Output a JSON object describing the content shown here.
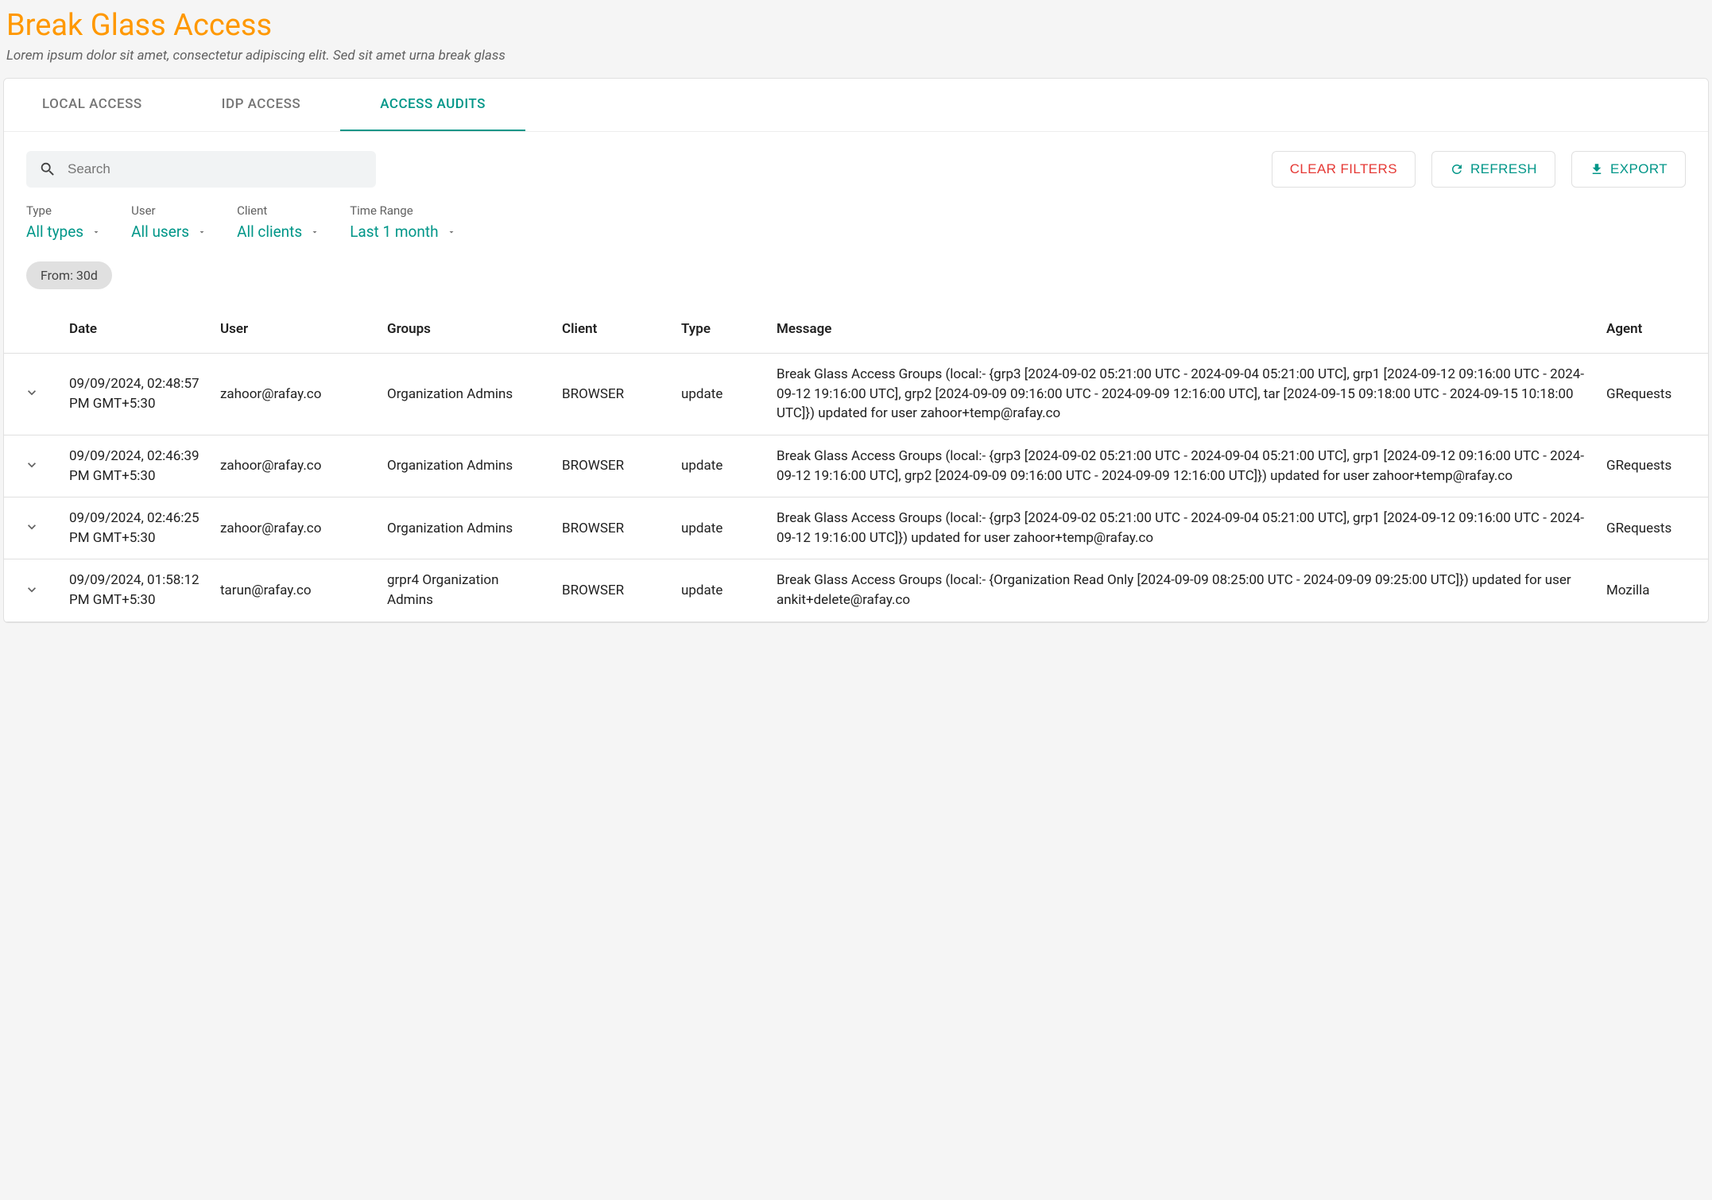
{
  "header": {
    "title": "Break Glass Access",
    "subtitle": "Lorem ipsum dolor sit amet, consectetur adipiscing elit. Sed sit amet urna break glass"
  },
  "tabs": [
    {
      "label": "LOCAL ACCESS",
      "active": false
    },
    {
      "label": "IDP ACCESS",
      "active": false
    },
    {
      "label": "ACCESS AUDITS",
      "active": true
    }
  ],
  "search": {
    "placeholder": "Search",
    "value": ""
  },
  "actions": {
    "clear": "CLEAR FILTERS",
    "refresh": "REFRESH",
    "export": "EXPORT"
  },
  "filters": {
    "type": {
      "label": "Type",
      "value": "All types"
    },
    "user": {
      "label": "User",
      "value": "All users"
    },
    "client": {
      "label": "Client",
      "value": "All clients"
    },
    "time_range": {
      "label": "Time Range",
      "value": "Last 1 month"
    }
  },
  "chips": [
    {
      "label": "From: 30d"
    }
  ],
  "columns": {
    "date": "Date",
    "user": "User",
    "groups": "Groups",
    "client": "Client",
    "type": "Type",
    "message": "Message",
    "agent": "Agent"
  },
  "rows": [
    {
      "date": "09/09/2024, 02:48:57 PM GMT+5:30",
      "user": "zahoor@rafay.co",
      "groups": "Organization Admins",
      "client": "BROWSER",
      "type": "update",
      "message": "Break Glass Access Groups (local:- {grp3 [2024-09-02 05:21:00 UTC - 2024-09-04 05:21:00 UTC], grp1 [2024-09-12 09:16:00 UTC - 2024-09-12 19:16:00 UTC], grp2 [2024-09-09 09:16:00 UTC - 2024-09-09 12:16:00 UTC], tar [2024-09-15 09:18:00 UTC - 2024-09-15 10:18:00 UTC]}) updated for user zahoor+temp@rafay.co",
      "agent": "GRequests"
    },
    {
      "date": "09/09/2024, 02:46:39 PM GMT+5:30",
      "user": "zahoor@rafay.co",
      "groups": "Organization Admins",
      "client": "BROWSER",
      "type": "update",
      "message": "Break Glass Access Groups (local:- {grp3 [2024-09-02 05:21:00 UTC - 2024-09-04 05:21:00 UTC], grp1 [2024-09-12 09:16:00 UTC - 2024-09-12 19:16:00 UTC], grp2 [2024-09-09 09:16:00 UTC - 2024-09-09 12:16:00 UTC]}) updated for user zahoor+temp@rafay.co",
      "agent": "GRequests"
    },
    {
      "date": "09/09/2024, 02:46:25 PM GMT+5:30",
      "user": "zahoor@rafay.co",
      "groups": "Organization Admins",
      "client": "BROWSER",
      "type": "update",
      "message": "Break Glass Access Groups (local:- {grp3 [2024-09-02 05:21:00 UTC - 2024-09-04 05:21:00 UTC], grp1 [2024-09-12 09:16:00 UTC - 2024-09-12 19:16:00 UTC]}) updated for user zahoor+temp@rafay.co",
      "agent": "GRequests"
    },
    {
      "date": "09/09/2024, 01:58:12 PM GMT+5:30",
      "user": "tarun@rafay.co",
      "groups": "grpr4 Organization Admins",
      "client": "BROWSER",
      "type": "update",
      "message": "Break Glass Access Groups (local:- {Organization Read Only [2024-09-09 08:25:00 UTC - 2024-09-09 09:25:00 UTC]}) updated for user ankit+delete@rafay.co",
      "agent": "Mozilla"
    }
  ]
}
